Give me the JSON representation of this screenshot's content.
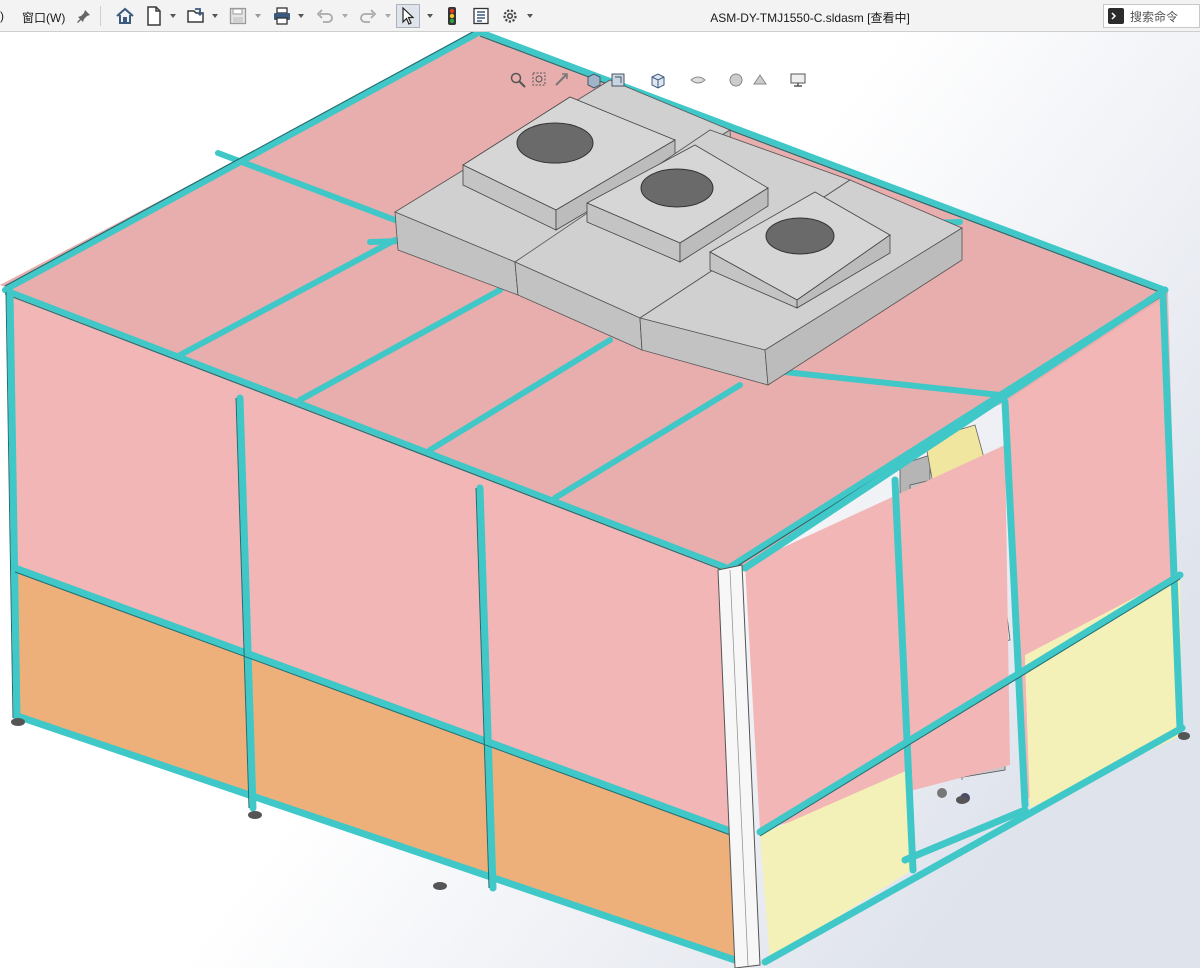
{
  "menu": {
    "partial_item": ")",
    "window_label": "窗口(W)"
  },
  "toolbar": {
    "icons": [
      "pin-icon",
      "home-icon",
      "new-document-icon",
      "open-icon",
      "save-icon",
      "print-icon",
      "undo-icon",
      "redo-icon",
      "select-arrow-icon",
      "traffic-light-icon",
      "file-properties-icon",
      "options-gear-icon"
    ],
    "active_tool": "select-arrow-icon"
  },
  "document": {
    "title": "ASM-DY-TMJ1550-C.sldasm [查看中]"
  },
  "search": {
    "placeholder": "搜索命令"
  },
  "heads_up_toolbar": {
    "icons": [
      "zoom-to-fit-icon",
      "zoom-area-icon",
      "previous-view-icon",
      "section-view-icon",
      "dynamic-annotation-icon",
      "view-orientation-icon",
      "display-style-icon",
      "hide-show-icon",
      "edit-appearance-icon",
      "apply-scene-icon",
      "view-settings-icon"
    ]
  },
  "colors": {
    "frame_teal": "#40c7c7",
    "frame_dark": "#1f6e70",
    "panel_pink": "#f2b6b6",
    "roof_pink": "#e8adad",
    "panel_orange": "#eeb07a",
    "panel_yellow": "#f3f1b8",
    "ffu_gray": "#cacaca",
    "ffu_top": "#d6d6d6",
    "fan_hole": "#6a6a6a",
    "viewport_gradient_end": "#dfe3ec"
  }
}
